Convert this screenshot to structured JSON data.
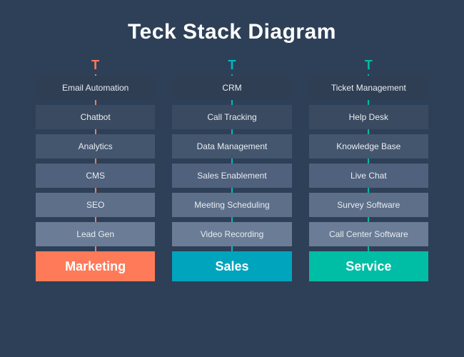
{
  "title": "Teck Stack Diagram",
  "marker": "T",
  "columns": [
    {
      "label": "Marketing",
      "items": [
        "Email Automation",
        "Chatbot",
        "Analytics",
        "CMS",
        "SEO",
        "Lead Gen"
      ]
    },
    {
      "label": "Sales",
      "items": [
        "CRM",
        "Call Tracking",
        "Data Management",
        "Sales Enablement",
        "Meeting Scheduling",
        "Video Recording"
      ]
    },
    {
      "label": "Service",
      "items": [
        "Ticket Management",
        "Help Desk",
        "Knowledge Base",
        "Live Chat",
        "Survey Software",
        "Call Center Software"
      ]
    }
  ]
}
